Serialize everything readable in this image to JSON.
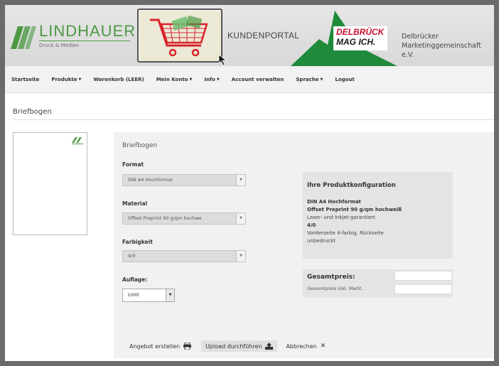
{
  "header": {
    "brand_name": "LINDHAUER",
    "brand_sub": "Druck & Medien",
    "portal_label": "KUNDENPORTAL",
    "partner_logo_line1": "DELBRÜCK",
    "partner_logo_line2": "MAG ICH.",
    "partner_name_line1": "Delbrücker",
    "partner_name_line2": "Marketinggemeinschaft e.V.",
    "colors": {
      "brand_green": "#4d9a45",
      "partner_red": "#c8102e",
      "mountain_green": "#1f8a3a",
      "cart_red": "#d9232a"
    },
    "cart_icon": "shopping-cart-icon"
  },
  "nav": {
    "items": [
      {
        "label": "Startseite",
        "has_dropdown": false
      },
      {
        "label": "Produkte",
        "has_dropdown": true
      },
      {
        "label": "Warenkorb (LEER)",
        "has_dropdown": false
      },
      {
        "label": "Mein Konto",
        "has_dropdown": true
      },
      {
        "label": "Info",
        "has_dropdown": true
      },
      {
        "label": "Account verwalten",
        "has_dropdown": false
      },
      {
        "label": "Sprache",
        "has_dropdown": true
      },
      {
        "label": "Logout",
        "has_dropdown": false
      }
    ]
  },
  "page": {
    "title": "Briefbogen"
  },
  "config": {
    "panel_title": "Briefbogen",
    "format": {
      "label": "Format",
      "value": "DIN A4 Hochformat"
    },
    "material": {
      "label": "Material",
      "value": "Offset Preprint 90 g/qm hochwe"
    },
    "farbigkeit": {
      "label": "Farbigkeit",
      "value": "4/0"
    },
    "auflage": {
      "label": "Auflage:",
      "value": "1000"
    }
  },
  "summary": {
    "title": "Ihre Produktkonfiguration",
    "format": "DIN A4 Hochformat",
    "material": "Offset Preprint 90 g/qm hochweiß",
    "material_note": "Laser- und Inkjet-garantiert",
    "farbigkeit": "4/0",
    "farbigkeit_note_1": "Vorderseite 4-farbig, Rückseite",
    "farbigkeit_note_2": "unbedruckt"
  },
  "price": {
    "label": "Gesamtpreis:",
    "sub_label": "Gesamtpreis inkl. MwSt."
  },
  "actions": {
    "offer": {
      "label": "Angebot erstellen",
      "icon": "printer-icon"
    },
    "upload": {
      "label": "Upload durchführen",
      "icon": "upload-icon"
    },
    "cancel": {
      "label": "Abbrechen",
      "icon": "close-icon"
    }
  }
}
